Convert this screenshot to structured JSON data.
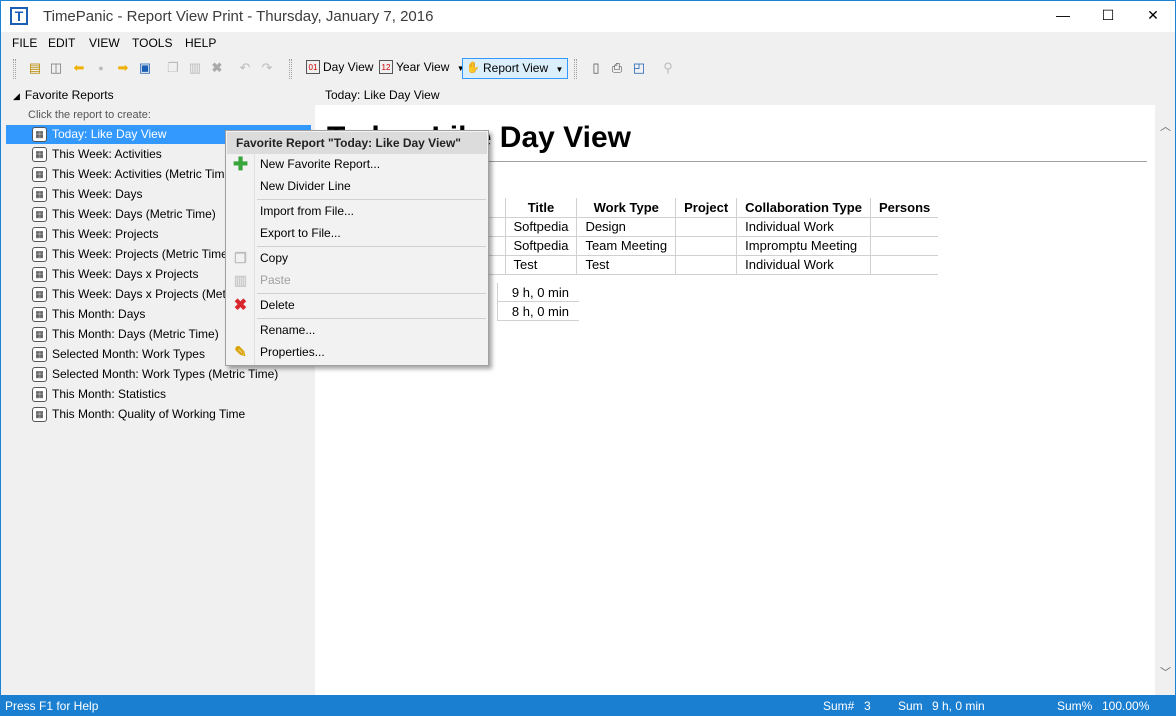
{
  "window": {
    "title": "TimePanic - Report View Print - Thursday, January 7, 2016",
    "app_icon": "T",
    "controls": {
      "minimize": "—",
      "maximize": "☐",
      "close": "✕"
    }
  },
  "menu": [
    "FILE",
    "EDIT",
    "VIEW",
    "TOOLS",
    "HELP"
  ],
  "toolbar": {
    "icons": [
      "new-icon",
      "open-icon",
      "back-icon",
      "record-icon",
      "forward-icon",
      "save-icon",
      "copy-icon",
      "paste-icon",
      "delete-icon",
      "undo-icon",
      "redo-icon"
    ],
    "day_view": "Day View",
    "year_view": "Year View",
    "report_view": "Report View",
    "view_icons": [
      "page-icon",
      "print-icon",
      "preview-icon",
      "link-icon"
    ]
  },
  "sidebar": {
    "header": "Favorite Reports",
    "hint": "Click the report to create:",
    "items": [
      "Today: Like Day View",
      "This Week: Activities",
      "This Week: Activities (Metric Time)",
      "This Week: Days",
      "This Week: Days (Metric Time)",
      "This Week: Projects",
      "This Week: Projects (Metric Time)",
      "This Week: Days x Projects",
      "This Week: Days x Projects (Metric Time)",
      "This Month: Days",
      "This Month: Days (Metric Time)",
      "Selected Month: Work Types",
      "Selected Month: Work Types (Metric Time)",
      "This Month: Statistics",
      "This Month: Quality of Working Time"
    ]
  },
  "document": {
    "tab_title": "Today: Like Day View",
    "heading": "Today: Like Day View",
    "columns": [
      "Title",
      "Work Type",
      "Project",
      "Collaboration Type",
      "Persons"
    ],
    "rows": [
      [
        "Softpedia",
        "Design",
        "",
        "Individual Work",
        ""
      ],
      [
        "Softpedia",
        "Team Meeting",
        "",
        "Impromptu Meeting",
        ""
      ],
      [
        "Test",
        "Test",
        "",
        "Individual Work",
        ""
      ]
    ],
    "sums": [
      "9 h, 0 min",
      "8 h, 0 min"
    ]
  },
  "context_menu": {
    "header": "Favorite Report \"Today: Like Day View\"",
    "items": {
      "new_report": "New Favorite Report...",
      "new_divider": "New Divider Line",
      "import": "Import from File...",
      "export": "Export to File...",
      "copy": "Copy",
      "paste": "Paste",
      "delete": "Delete",
      "rename": "Rename...",
      "properties": "Properties..."
    }
  },
  "status": {
    "help": "Press F1 for Help",
    "sum_count_label": "Sum#",
    "sum_count": "3",
    "sum_label": "Sum",
    "sum_value": "9 h, 0 min",
    "sum_pct_label": "Sum%",
    "sum_pct": "100.00%"
  },
  "colors": {
    "accent": "#3399ff",
    "statusbar": "#1b7fd1",
    "delete_red": "#d9262c",
    "add_green": "#3aa53a"
  }
}
